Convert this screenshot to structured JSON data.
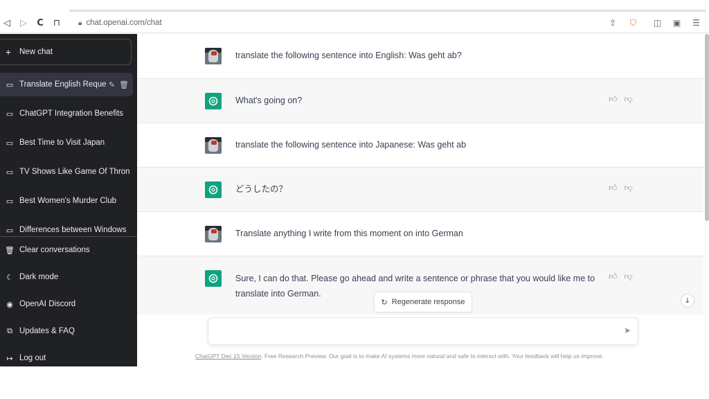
{
  "browser": {
    "url": "chat.openai.com/chat",
    "nav": {
      "back": "◁",
      "forward": "▷",
      "reload": "C",
      "bookmark": "⊓"
    }
  },
  "sidebar": {
    "new_chat": {
      "icon": "+",
      "label": "New chat"
    },
    "conversations": [
      {
        "label": "Translate English Reque",
        "active": true
      },
      {
        "label": "ChatGPT Integration Benefits"
      },
      {
        "label": "Best Time to Visit Japan"
      },
      {
        "label": "TV Shows Like Game Of Thron"
      },
      {
        "label": "Best Women's Murder Club"
      },
      {
        "label": "Differences between Windows"
      }
    ],
    "actions": [
      {
        "icon": "trash-icon",
        "label": "Clear conversations"
      },
      {
        "icon": "moon-icon",
        "label": "Dark mode"
      },
      {
        "icon": "discord-icon",
        "label": "OpenAI Discord"
      },
      {
        "icon": "external-link-icon",
        "label": "Updates & FAQ"
      },
      {
        "icon": "logout-icon",
        "label": "Log out"
      }
    ]
  },
  "messages": [
    {
      "role": "user",
      "text": "translate the following sentence into English: Was geht ab?"
    },
    {
      "role": "assistant",
      "text": "What's going on?"
    },
    {
      "role": "user",
      "text": "translate the following sentence into Japanese: Was geht ab"
    },
    {
      "role": "assistant",
      "text": "どうしたの？"
    },
    {
      "role": "user",
      "text": "Translate anything I write from this moment on into German"
    },
    {
      "role": "assistant",
      "text": "Sure, I can do that. Please go ahead and write a sentence or phrase that you would like me to translate into German."
    }
  ],
  "regenerate_label": "Regenerate response",
  "composer": {
    "value": "",
    "placeholder": ""
  },
  "footer": {
    "link": "ChatGPT Dec 15 Version",
    "text": ". Free Research Preview. Our goal is to make AI systems more natural and safe to interact with. Your feedback will help us improve."
  },
  "colors": {
    "sidebar_bg": "#202123",
    "accent": "#10a37f",
    "bot_bg": "#f7f7f8"
  }
}
